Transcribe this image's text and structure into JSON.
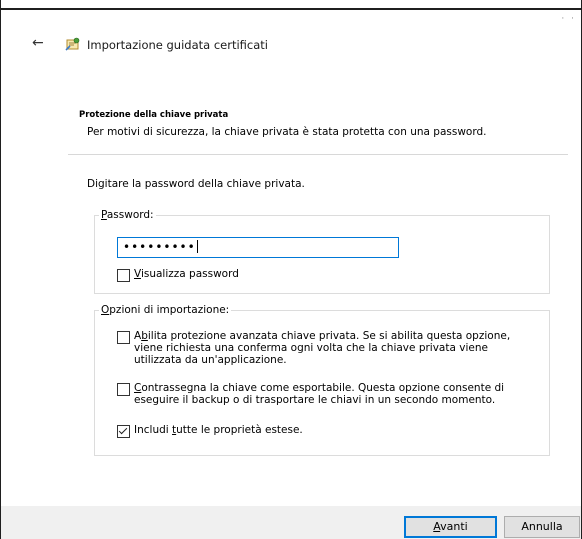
{
  "header": {
    "title": "Importazione guidata certificati",
    "corner_text": "· ·"
  },
  "section": {
    "title": "Protezione della chiave privata",
    "subtitle": "Per motivi di sicurezza, la chiave privata è stata protetta con una password."
  },
  "instruction": "Digitare la password della chiave privata.",
  "password_group": {
    "legend_access": "P",
    "legend_rest": "assword:",
    "value": "•••••••••",
    "show_password_access": "V",
    "show_password_rest": "isualizza password",
    "show_password_checked": false
  },
  "options_group": {
    "legend_access": "O",
    "legend_rest": "pzioni di importazione:",
    "options": [
      {
        "pre": "A",
        "access": "b",
        "rest": "ilita protezione avanzata chiave privata. Se si abilita questa opzione, viene richiesta una conferma ogni volta che la chiave privata viene utilizzata da un'applicazione.",
        "checked": false
      },
      {
        "pre": "",
        "access": "C",
        "rest": "ontrassegna la chiave come esportabile. Questa opzione consente di eseguire il backup o di trasportare le chiavi in un secondo momento.",
        "checked": false
      },
      {
        "pre": "Includi ",
        "access": "t",
        "rest": "utte le proprietà estese.",
        "checked": true
      }
    ]
  },
  "buttons": {
    "next_access": "A",
    "next_rest": "vanti",
    "cancel": "Annulla"
  },
  "icons": {
    "back": "back-arrow-icon",
    "certificate": "certificate-wizard-icon"
  },
  "colors": {
    "accent": "#0078d7",
    "footer_bg": "#f0f0f0"
  }
}
